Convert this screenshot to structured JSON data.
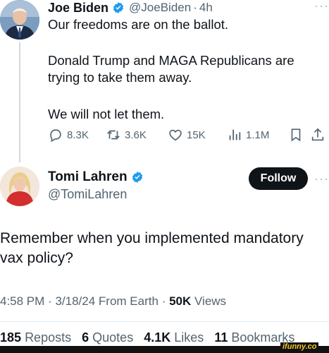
{
  "parent_tweet": {
    "display_name": "Joe Biden",
    "handle": "@JoeBiden",
    "separator": "·",
    "time": "4h",
    "more": "···",
    "text_lines": [
      "Our freedoms are on the ballot.",
      "Donald Trump and MAGA Republicans are trying to take them away.",
      "We will not let them."
    ],
    "actions": {
      "replies": "8.3K",
      "reposts": "3.6K",
      "likes": "15K",
      "views": "1.1M"
    }
  },
  "main_tweet": {
    "display_name": "Tomi Lahren",
    "handle": "@TomiLahren",
    "follow_label": "Follow",
    "more": "···",
    "text": "Remember when you implemented mandatory vax policy?",
    "time": "4:58 PM",
    "sep": "·",
    "date": "3/18/24",
    "source": "From Earth",
    "views_count": "50K",
    "views_label": "Views",
    "stats": {
      "reposts_count": "185",
      "reposts_label": "Reposts",
      "quotes_count": "6",
      "quotes_label": "Quotes",
      "likes_count": "4.1K",
      "likes_label": "Likes",
      "bookmarks_count": "11",
      "bookmarks_label": "Bookmarks"
    }
  },
  "watermark": "ifunny.co",
  "colors": {
    "text": "#0f1419",
    "secondary": "#536471",
    "verified": "#1d9bf0",
    "follow_bg": "#0f1419",
    "thread_line": "#cfd9de"
  },
  "icons": [
    "verified-badge-icon",
    "reply-icon",
    "repost-icon",
    "like-icon",
    "views-icon",
    "bookmark-icon",
    "share-icon",
    "more-icon"
  ]
}
